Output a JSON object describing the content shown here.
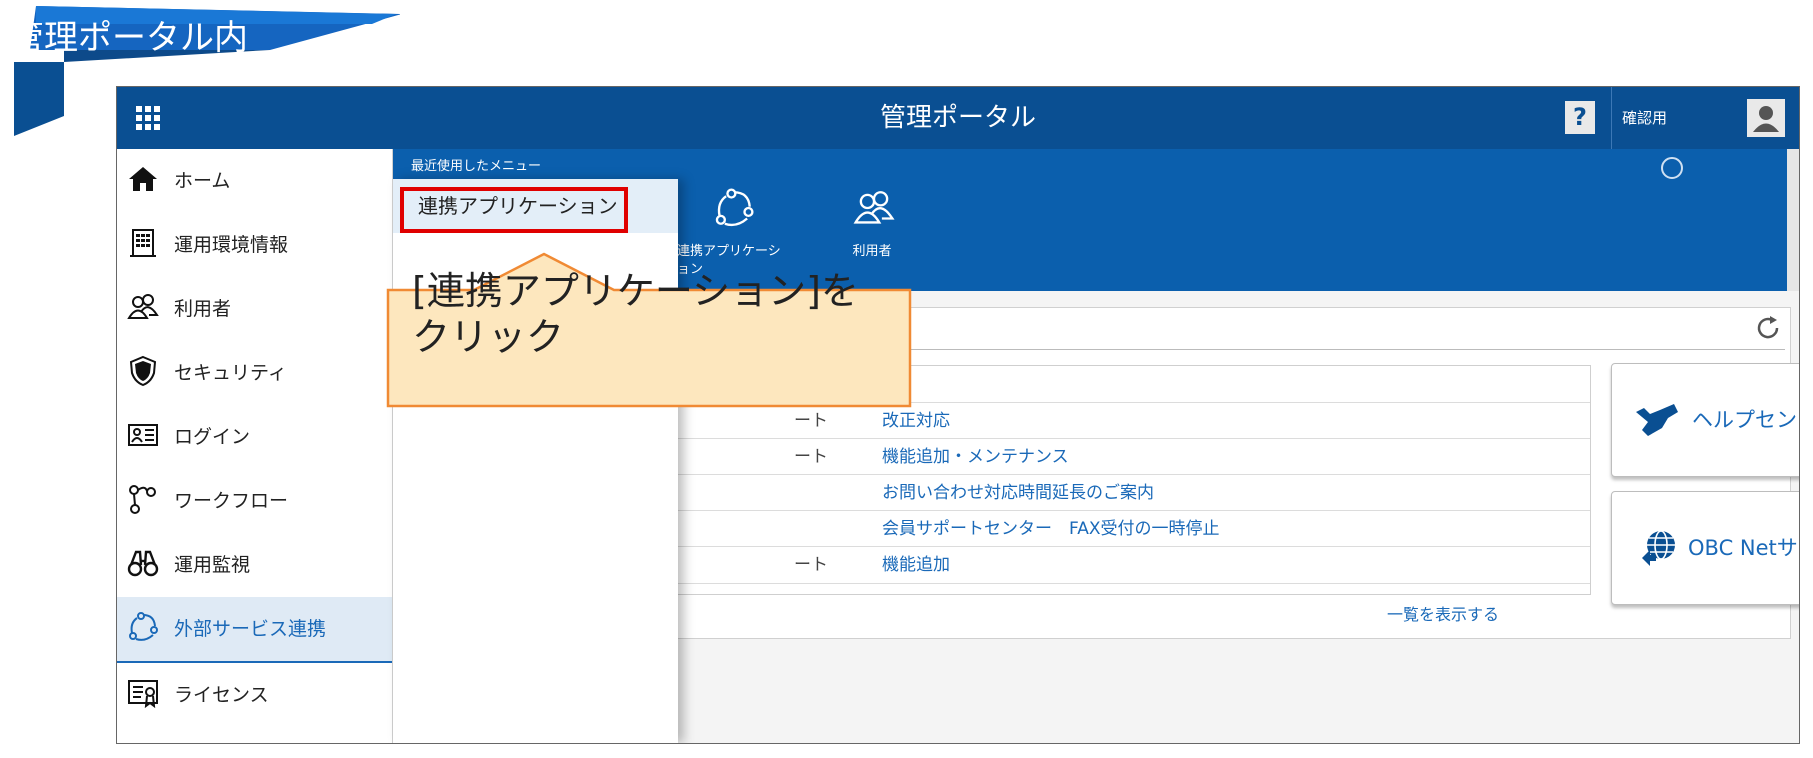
{
  "banner": {
    "title": "管理ポータル内"
  },
  "topbar": {
    "title": "管理ポータル",
    "help_label": "?",
    "user_label": "確認用"
  },
  "sidebar": {
    "items": [
      {
        "label": "ホーム",
        "icon": "home-icon"
      },
      {
        "label": "運用環境情報",
        "icon": "building-icon"
      },
      {
        "label": "利用者",
        "icon": "users-icon"
      },
      {
        "label": "セキュリティ",
        "icon": "shield-icon"
      },
      {
        "label": "ログイン",
        "icon": "id-card-icon"
      },
      {
        "label": "ワークフロー",
        "icon": "workflow-icon"
      },
      {
        "label": "運用監視",
        "icon": "binoculars-icon"
      },
      {
        "label": "外部サービス連携",
        "icon": "link-apps-icon",
        "active": true
      },
      {
        "label": "ライセンス",
        "icon": "license-icon"
      }
    ]
  },
  "recent": {
    "section_label": "最近使用したメニュー",
    "menu_item": "連携アプリケーション",
    "tiles": [
      {
        "label": "連携アプリケーシ ョン",
        "icon": "link-apps-icon"
      },
      {
        "label": "利用者",
        "icon": "users-icon"
      }
    ]
  },
  "news": {
    "rows": [
      {
        "category": "ート",
        "title": "改正対応"
      },
      {
        "category": "ート",
        "title": "機能追加・メンテナンス"
      },
      {
        "category": "",
        "title": "お問い合わせ対応時間延長のご案内"
      },
      {
        "category": "",
        "title": "会員サポートセンター　FAX受付の一時停止"
      },
      {
        "category": "ート",
        "title": "機能追加"
      }
    ],
    "show_all": "一覧を表示する"
  },
  "side_buttons": {
    "help_center": "ヘルプセンター",
    "obc_net": "OBC Netサービス"
  },
  "callout": {
    "line1": "[連携アプリケーション]を",
    "line2": "クリック"
  },
  "colors": {
    "topbar": "#0a4f92",
    "band": "#0b5fad",
    "link": "#1a69b8",
    "highlight": "#e00000",
    "callout_fill": "#fde7be",
    "callout_border": "#f08a34"
  }
}
